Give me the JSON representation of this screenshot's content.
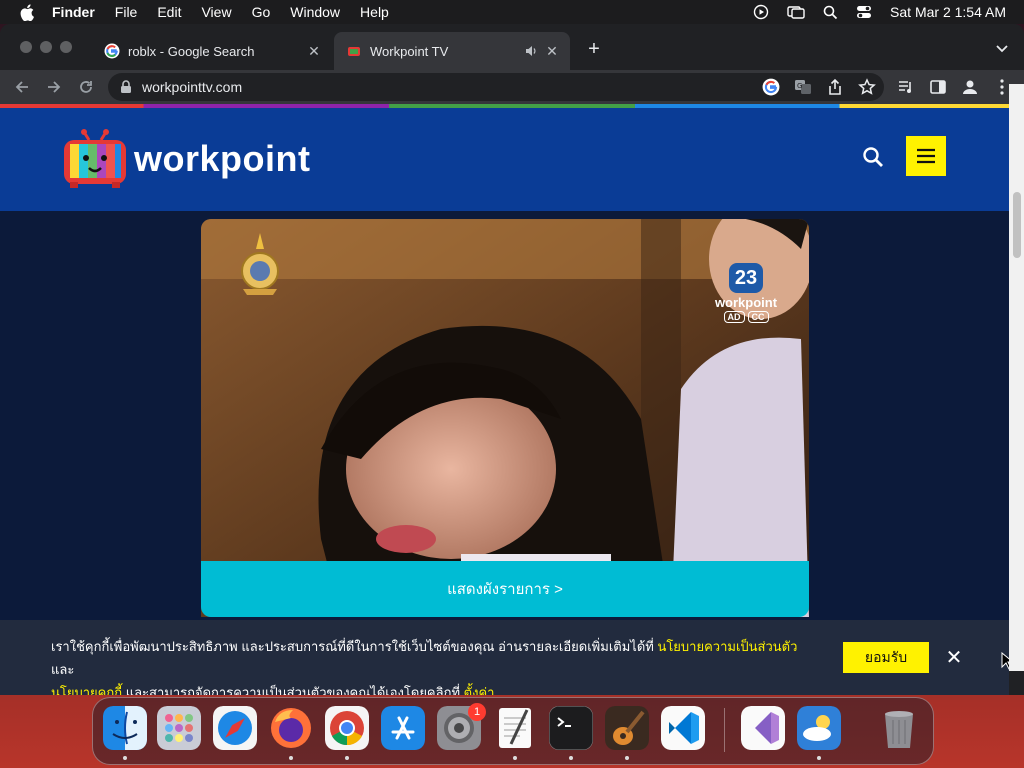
{
  "menubar": {
    "app_name": "Finder",
    "items": [
      "File",
      "Edit",
      "View",
      "Go",
      "Window",
      "Help"
    ],
    "datetime": "Sat Mar 2  1:54 AM"
  },
  "browser": {
    "tabs": [
      {
        "title": "roblx - Google Search",
        "favicon": "google-icon",
        "active": false
      },
      {
        "title": "Workpoint TV",
        "favicon": "workpoint-icon",
        "active": true,
        "audio": true
      }
    ],
    "address": "workpointtv.com"
  },
  "site": {
    "logo_text": "workpoint",
    "brand_colors": {
      "header": "#0a3c96",
      "accent": "#fff200",
      "schedule": "#00bcd4"
    },
    "player": {
      "channel_number": "23",
      "channel_name": "workpoint",
      "badge_ad": "AD",
      "badge_cc": "CC",
      "seal_text": "ทรงพระเจริญ"
    },
    "schedule_label": "แสดงผังรายการ >"
  },
  "cookie_banner": {
    "text_1": "เราใช้คุกกี้เพื่อพัฒนาประสิทธิภาพ และประสบการณ์ที่ดีในการใช้เว็บไซต์ของคุณ อ่านรายละเอียดเพิ่มเติมได้ที่ ",
    "link_privacy": "นโยบายความเป็นส่วนตัว",
    "text_2": " และ",
    "link_cookie": "นโยบายคุกกี้",
    "text_3": " และสามารถจัดการความเป็นส่วนตัวของคุณได้เองโดยคลิกที่ ",
    "link_settings": "ตั้งค่า",
    "accept_label": "ยอมรับ",
    "close_label": "✕"
  },
  "dock": {
    "items": [
      "finder-icon",
      "launchpad-icon",
      "safari-icon",
      "firefox-icon",
      "chrome-icon",
      "app-store-icon",
      "system-settings-icon",
      "textedit-icon",
      "terminal-icon",
      "garageband-icon",
      "vscode-icon",
      "visual-studio-icon",
      "weather-icon",
      "trash-icon"
    ],
    "settings_badge": "1"
  }
}
